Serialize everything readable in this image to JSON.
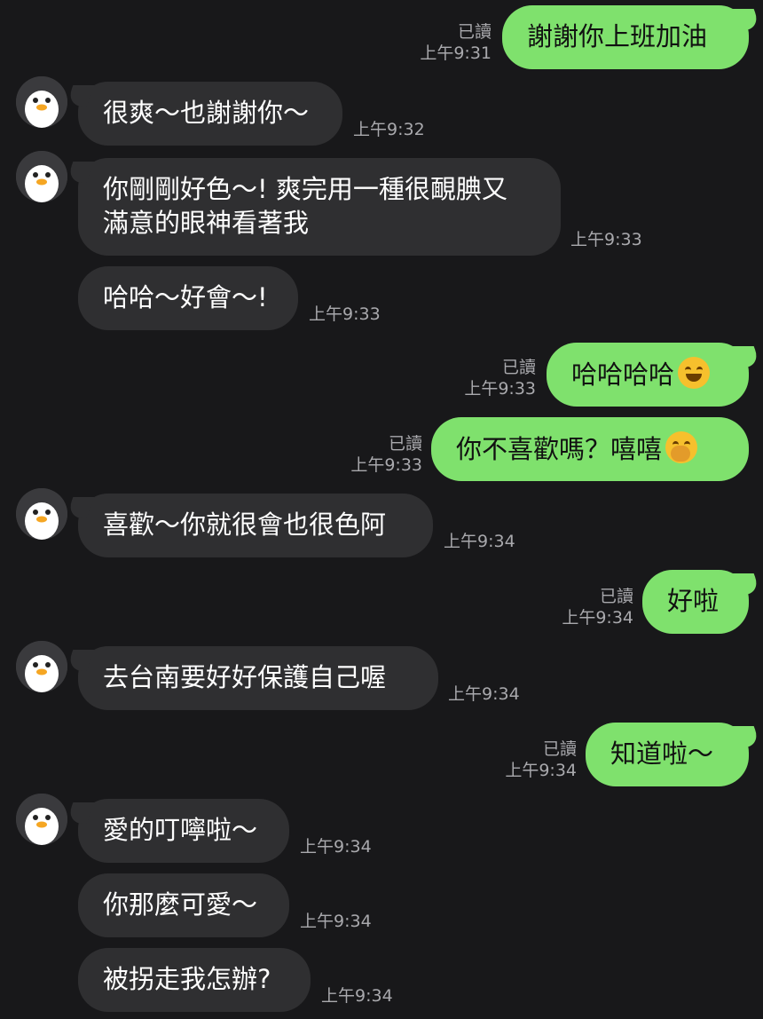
{
  "colors": {
    "background": "#18181a",
    "incoming_bubble": "#2f2f31",
    "outgoing_bubble": "#7fe16d",
    "meta_text": "#a9a9ad"
  },
  "read_label": "已讀",
  "messages": [
    {
      "dir": "out",
      "text": "謝謝你上班加油",
      "time": "上午9:31",
      "read": "已讀"
    },
    {
      "dir": "in",
      "text": "很爽～也謝謝你～",
      "time": "上午9:32"
    },
    {
      "dir": "in",
      "text": "你剛剛好色～! 爽完用一種很靦腆又",
      "text2": "滿意的眼神看著我",
      "time": "上午9:33"
    },
    {
      "dir": "in",
      "text": "哈哈～好會～!",
      "time": "上午9:33"
    },
    {
      "dir": "out",
      "text": "哈哈哈哈",
      "emoji": "tears-of-joy-emoji",
      "time": "上午9:33",
      "read": "已讀"
    },
    {
      "dir": "out",
      "text": "你不喜歡嗎？嘻嘻",
      "emoji": "hand-over-mouth-emoji",
      "time": "上午9:33",
      "read": "已讀"
    },
    {
      "dir": "in",
      "text": "喜歡～你就很會也很色阿",
      "time": "上午9:34"
    },
    {
      "dir": "out",
      "text": "好啦",
      "time": "上午9:34",
      "read": "已讀"
    },
    {
      "dir": "in",
      "text": "去台南要好好保護自己喔",
      "time": "上午9:34"
    },
    {
      "dir": "out",
      "text": "知道啦～",
      "time": "上午9:34",
      "read": "已讀"
    },
    {
      "dir": "in",
      "text": "愛的叮嚀啦～",
      "time": "上午9:34"
    },
    {
      "dir": "in",
      "text": "你那麼可愛～",
      "time": "上午9:34"
    },
    {
      "dir": "in",
      "text": "被拐走我怎辦?",
      "time": "上午9:34"
    }
  ]
}
